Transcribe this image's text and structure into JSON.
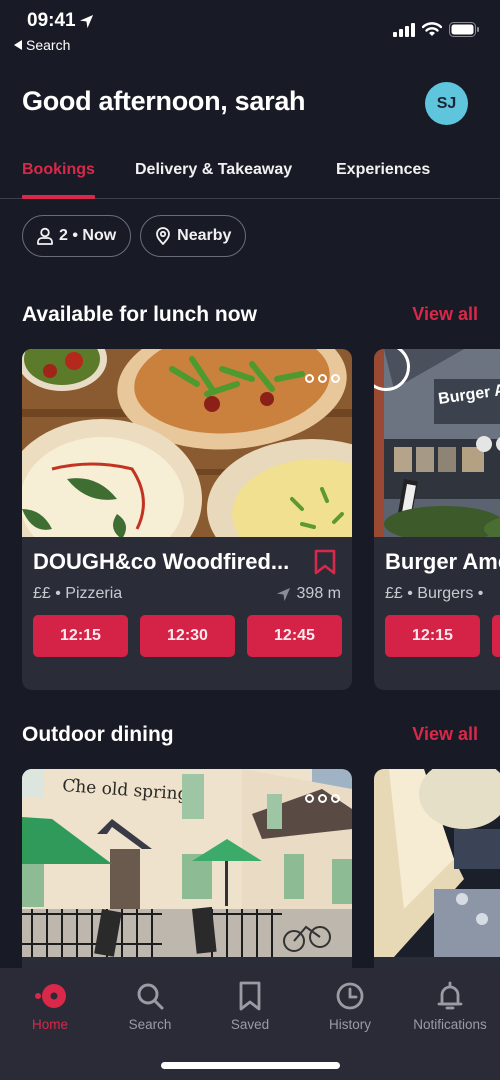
{
  "status_bar": {
    "time": "09:41",
    "back_label": "Search"
  },
  "header": {
    "greeting": "Good afternoon, sarah",
    "avatar_initials": "SJ"
  },
  "tabs": [
    {
      "label": "Bookings",
      "active": true
    },
    {
      "label": "Delivery & Takeaway",
      "active": false
    },
    {
      "label": "Experiences",
      "active": false
    }
  ],
  "filters": {
    "party": "2 • Now",
    "location": "Nearby"
  },
  "sections": [
    {
      "title": "Available for lunch now",
      "view_all": "View all",
      "cards": [
        {
          "name": "DOUGH&co Woodfired...",
          "meta": "££ • Pizzeria",
          "distance": "398 m",
          "slots": [
            "12:15",
            "12:30",
            "12:45"
          ]
        },
        {
          "name": "Burger Ame",
          "meta": "££ • Burgers •",
          "slots": [
            "12:15",
            ""
          ]
        }
      ]
    },
    {
      "title": "Outdoor dining",
      "view_all": "View all",
      "cards": [
        {
          "name": "The Old Spring",
          "sign_text": "The Old Spring"
        },
        {
          "name": ""
        }
      ]
    }
  ],
  "bottom_nav": [
    {
      "label": "Home",
      "icon": "home-icon",
      "active": true
    },
    {
      "label": "Search",
      "icon": "search-icon",
      "active": false
    },
    {
      "label": "Saved",
      "icon": "bookmark-icon",
      "active": false
    },
    {
      "label": "History",
      "icon": "clock-icon",
      "active": false
    },
    {
      "label": "Notifications",
      "icon": "bell-icon",
      "active": false
    }
  ],
  "colors": {
    "accent": "#d9284a",
    "background": "#181b25",
    "card": "#2a2d38",
    "avatar": "#5ec5dd"
  }
}
